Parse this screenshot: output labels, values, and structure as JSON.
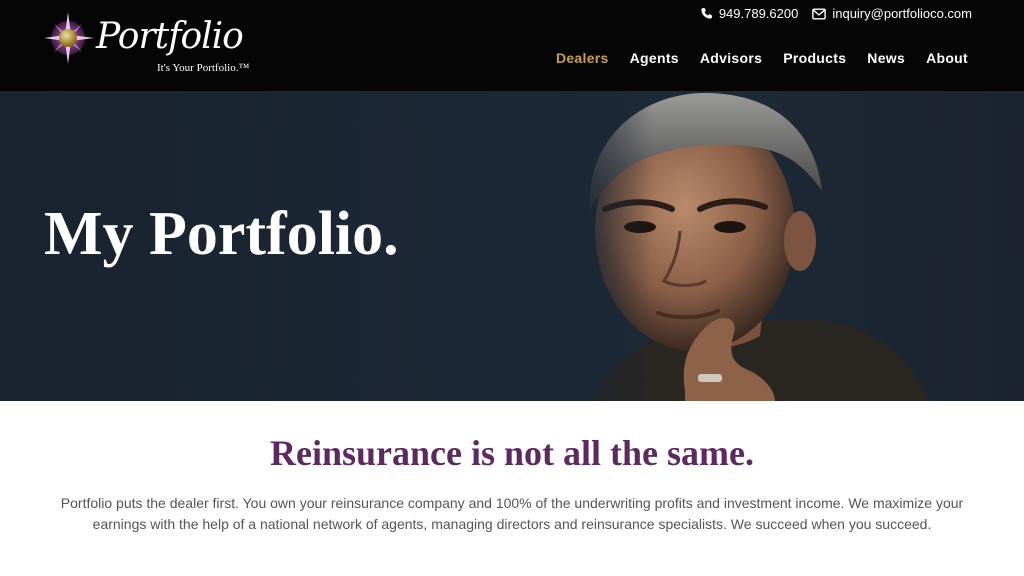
{
  "brand": {
    "wordmark": "Portfolio",
    "tagline": "It's Your Portfolio.™",
    "colors": {
      "accent_gold": "#c8a150",
      "purple": "#5c2a5e",
      "header_bg": "#050505"
    }
  },
  "contact": {
    "phone": "949.789.6200",
    "phone_icon": "phone-icon",
    "email": "inquiry@portfolioco.com",
    "email_icon": "envelope-icon"
  },
  "nav": {
    "items": [
      {
        "label": "Dealers",
        "active": true
      },
      {
        "label": "Agents",
        "active": false
      },
      {
        "label": "Advisors",
        "active": false
      },
      {
        "label": "Products",
        "active": false
      },
      {
        "label": "News",
        "active": false
      },
      {
        "label": "About",
        "active": false
      }
    ]
  },
  "hero": {
    "title": "My Portfolio."
  },
  "intro": {
    "heading": "Reinsurance is not all the same.",
    "body": "Portfolio puts the dealer first. You own your reinsurance company and 100% of the underwriting profits and investment income. We maximize your earnings with the help of a national network of agents, managing directors and reinsurance specialists. We succeed when you succeed."
  }
}
